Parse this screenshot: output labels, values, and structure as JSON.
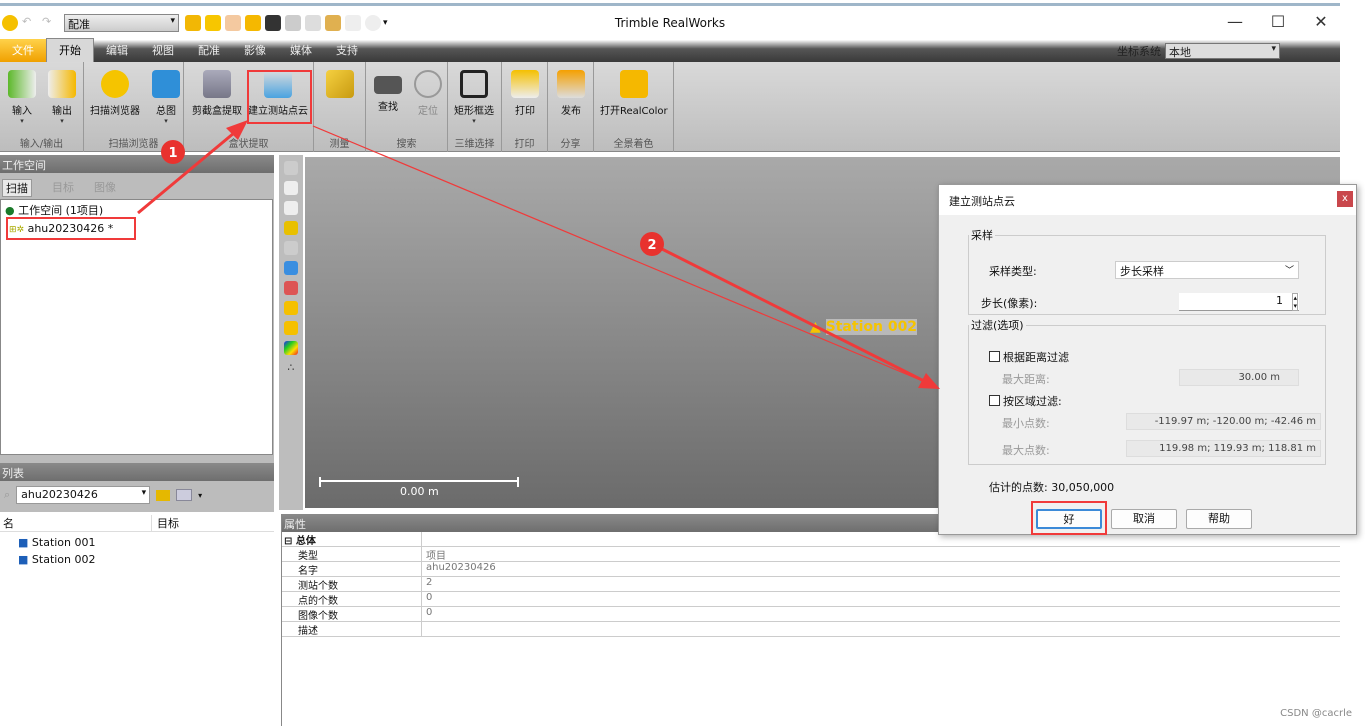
{
  "app": {
    "title": "Trimble RealWorks"
  },
  "quick_access": {
    "combo": "配准"
  },
  "window_controls": {
    "minimize": "—",
    "maximize": "☐",
    "close": "✕"
  },
  "tabs": [
    "文件",
    "开始",
    "编辑",
    "视图",
    "配准",
    "影像",
    "媒体",
    "支持"
  ],
  "coord": {
    "label": "坐标系统",
    "value": "本地"
  },
  "ribbon": {
    "groups": [
      {
        "label": "输入/输出",
        "buttons": [
          "输入",
          "输出"
        ]
      },
      {
        "label": "扫描浏览器",
        "buttons": [
          "扫描浏览器",
          "总图"
        ]
      },
      {
        "label": "盒状提取",
        "buttons": [
          "剪截盒提取",
          "建立测站点云"
        ]
      },
      {
        "label": "测量",
        "buttons": [
          ""
        ]
      },
      {
        "label": "搜索",
        "buttons": [
          "查找",
          "定位"
        ]
      },
      {
        "label": "三维选择",
        "buttons": [
          "矩形框选"
        ]
      },
      {
        "label": "打印",
        "buttons": [
          "打印"
        ]
      },
      {
        "label": "分享",
        "buttons": [
          "发布"
        ]
      },
      {
        "label": "全景着色",
        "buttons": [
          "打开RealColor"
        ]
      }
    ]
  },
  "workspace": {
    "title": "工作空间",
    "tabs": [
      "扫描",
      "目标",
      "图像"
    ],
    "root": "工作空间 (1项目)",
    "project": "ahu20230426",
    "project_flag": "*"
  },
  "list": {
    "title": "列表",
    "filter": "ahu20230426",
    "columns": [
      "名",
      "目标"
    ],
    "rows": [
      "Station 001",
      "Station 002"
    ]
  },
  "viewport": {
    "station_label": "Station 002",
    "scale": "0.00 m"
  },
  "properties": {
    "title": "属性",
    "group": "总体",
    "rows": [
      {
        "k": "类型",
        "v": "项目"
      },
      {
        "k": "名字",
        "v": "ahu20230426"
      },
      {
        "k": "测站个数",
        "v": "2"
      },
      {
        "k": "点的个数",
        "v": "0"
      },
      {
        "k": "图像个数",
        "v": "0"
      },
      {
        "k": "描述",
        "v": ""
      }
    ]
  },
  "dialog": {
    "title": "建立测站点云",
    "close": "x",
    "sampling": {
      "legend": "采样",
      "type_label": "采样类型:",
      "type_value": "步长采样",
      "step_label": "步长(像素):",
      "step_value": "1"
    },
    "filter": {
      "legend": "过滤(选项)",
      "by_distance": "根据距离过滤",
      "max_dist_label": "最大距离:",
      "max_dist_value": "30.00 m",
      "by_region": "按区域过滤:",
      "min_label": "最小点数:",
      "min_value": "-119.97 m; -120.00 m; -42.46 m",
      "max_label": "最大点数:",
      "max_value": "119.98 m; 119.93 m; 118.81 m"
    },
    "estimate": "估计的点数: 30,050,000",
    "ok": "好",
    "cancel": "取消",
    "help": "帮助"
  },
  "annotations": {
    "step1": "1",
    "step2": "2",
    "color": "#f03a3a"
  },
  "watermark": "CSDN @cacrle"
}
